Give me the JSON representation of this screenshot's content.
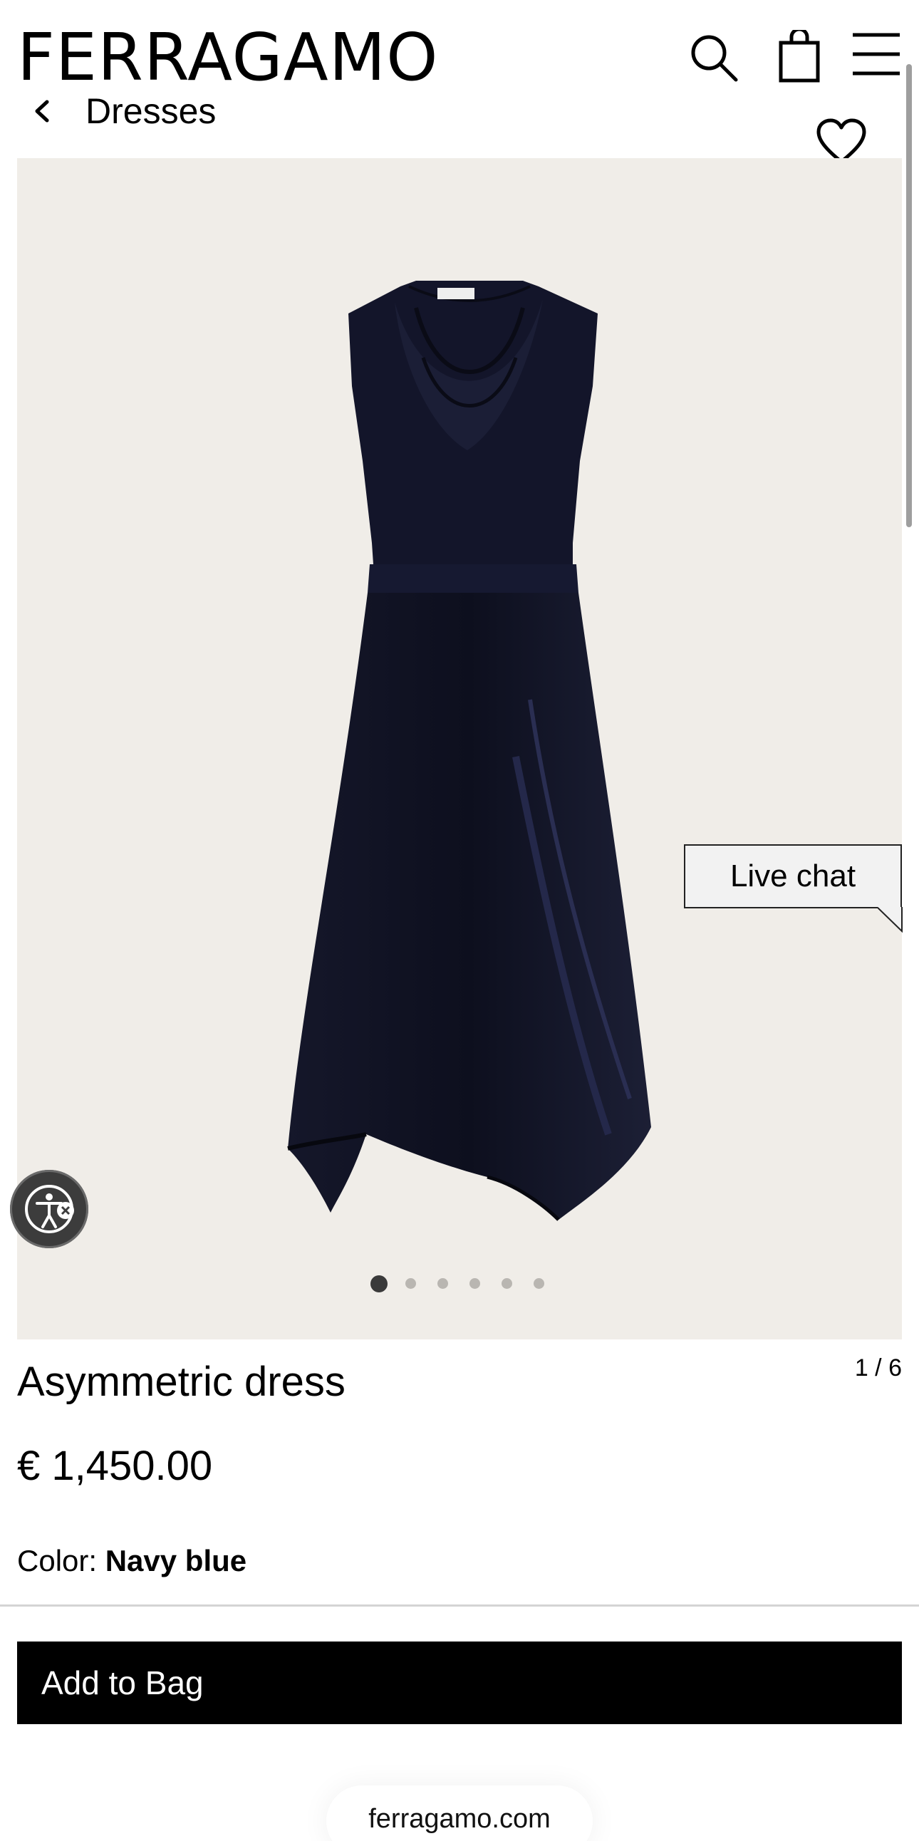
{
  "header": {
    "logo": "FERRAGAMO",
    "icons": [
      "search-icon",
      "shopping-bag-icon",
      "hamburger-menu-icon"
    ]
  },
  "breadcrumb": {
    "label": "Dresses"
  },
  "gallery": {
    "image_subject": "navy blue sleeveless asymmetric dress with cowl neck and tie belt",
    "background_color": "#f0ede8",
    "dot_count": 6,
    "active_dot": 1,
    "counter": "1 / 6"
  },
  "live_chat": {
    "label": "Live chat"
  },
  "product": {
    "title": "Asymmetric dress",
    "price": "€ 1,450.00",
    "color_label": "Color:",
    "color_value": "Navy blue"
  },
  "actions": {
    "add_to_bag": "Add to Bag"
  },
  "browser": {
    "url": "ferragamo.com"
  },
  "colors": {
    "dress": "#121424",
    "button_bg": "#000000",
    "button_text": "#ffffff"
  }
}
